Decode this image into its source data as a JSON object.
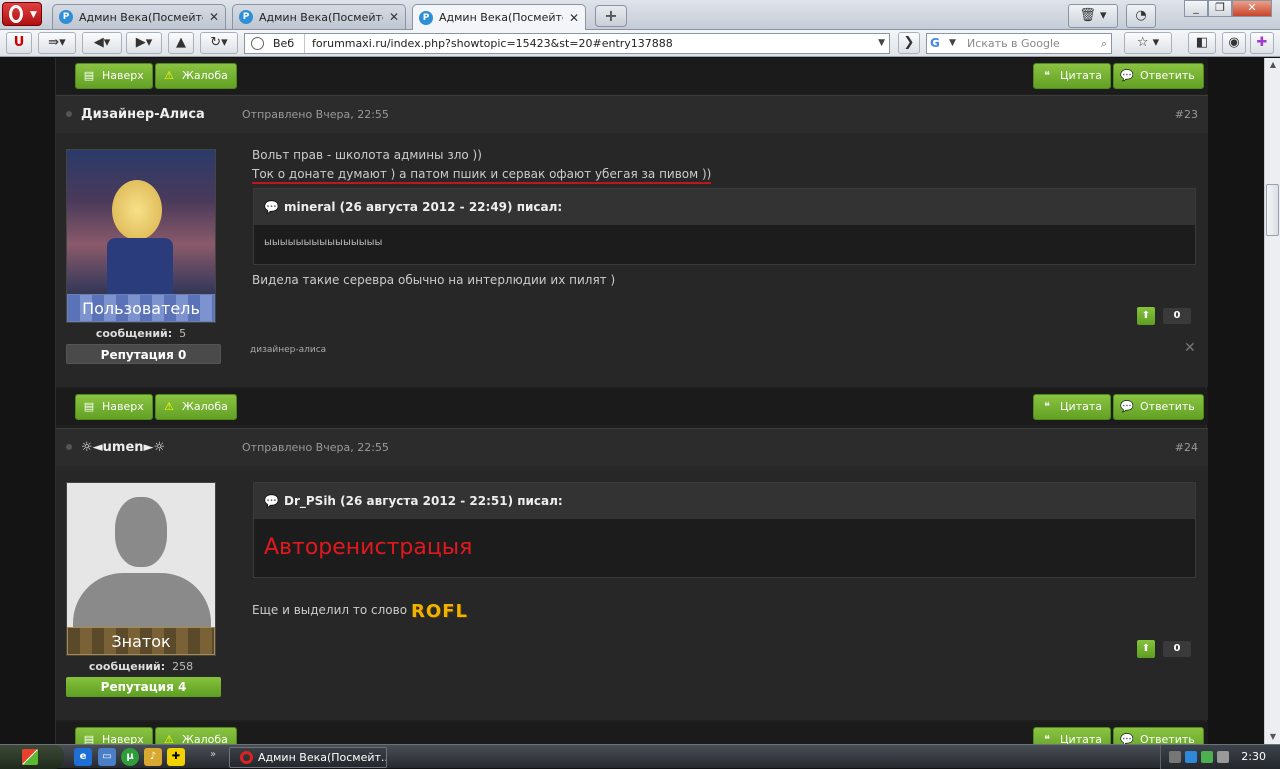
{
  "browser": {
    "tabs": [
      {
        "label": "Админ Века(Посмейтес...",
        "active": false
      },
      {
        "label": "Админ Века(Посмейтес...",
        "active": false
      },
      {
        "label": "Админ Века(Посмейтес...",
        "active": true
      }
    ],
    "fav_letter": "P",
    "new_tab_symbol": "+",
    "address_prefix": "Веб",
    "url": "forummaxi.ru/index.php?showtopic=15423&st=20#entry137888",
    "search_placeholder": "Искать в Google",
    "window_controls": {
      "minimize": "_",
      "restore": "❐",
      "close": "✕"
    }
  },
  "buttons": {
    "top": "Наверх",
    "report": "Жалоба",
    "quote": "Цитата",
    "reply": "Ответить"
  },
  "posts": [
    {
      "author": "Дизайнер-Алиса",
      "date": "Отправлено Вчера, 22:55",
      "number": "#23",
      "rank": "Пользователь",
      "messages_label": "сообщений:",
      "messages_count": "5",
      "reputation": "Репутация 0",
      "line1": "Вольт прав - школота админы зло ))",
      "line2": "Ток о донате думают ) а патом пшик и сервак офают убегая за пивом ))",
      "quote_header": "mineral (26 августа 2012 - 22:49) писал:",
      "quote_body": "ыыыыыыыыыыыыыыы",
      "line3": "Видела такие серевра обычно на интерлюдии их пилят )",
      "score": "0",
      "signature": "дизайнер-алиса"
    },
    {
      "author": "☼◄umen►☼",
      "date": "Отправлено Вчера, 22:55",
      "number": "#24",
      "rank": "Знаток",
      "messages_label": "сообщений:",
      "messages_count": "258",
      "reputation": "Репутация 4",
      "quote_header": "Dr_PSih (26 августа 2012 - 22:51) писал:",
      "quote_body": "Авторенистрацыя",
      "line1": "Еще и выделил то слово",
      "rofl": "ROFL",
      "score": "0"
    }
  ],
  "taskbar": {
    "task_label": "Админ Века(Посмейт...",
    "clock": "2:30"
  },
  "colors": {
    "green_button": "#6aa82b",
    "red_underline": "#c0151b",
    "quote_red": "#e1181e"
  }
}
